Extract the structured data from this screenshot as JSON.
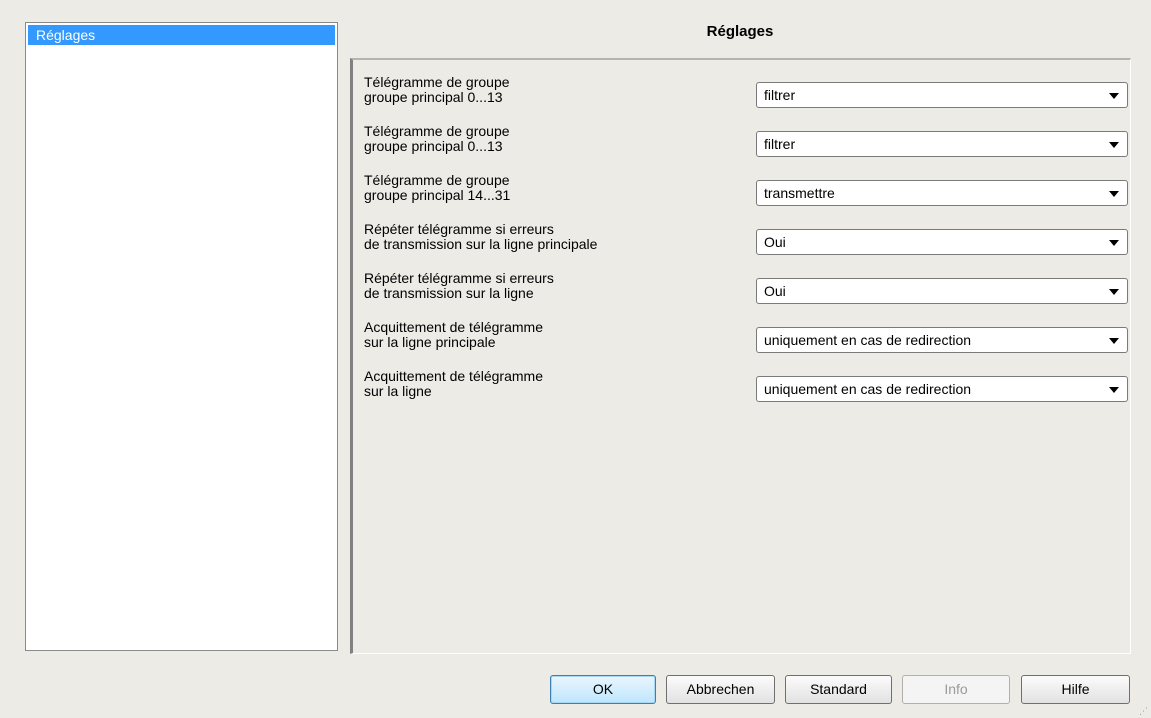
{
  "tree": {
    "items": [
      {
        "label": "Réglages",
        "selected": true
      }
    ]
  },
  "page_title": "Réglages",
  "parameters": [
    {
      "label_line1": "Télégramme de groupe",
      "label_line2": "groupe principal 0...13",
      "value": "filtrer"
    },
    {
      "label_line1": "Télégramme de groupe",
      "label_line2": "groupe principal 0...13",
      "value": "filtrer"
    },
    {
      "label_line1": "Télégramme de groupe",
      "label_line2": "groupe principal 14...31",
      "value": "transmettre"
    },
    {
      "label_line1": "Répéter télégramme si erreurs",
      "label_line2": "de transmission sur la ligne principale",
      "value": "Oui"
    },
    {
      "label_line1": "Répéter télégramme si erreurs",
      "label_line2": "de transmission sur la ligne",
      "value": "Oui"
    },
    {
      "label_line1": "Acquittement de télégramme",
      "label_line2": "sur la ligne principale",
      "value": "uniquement en cas de redirection"
    },
    {
      "label_line1": "Acquittement de télégramme",
      "label_line2": "sur la ligne",
      "value": "uniquement en cas de redirection"
    }
  ],
  "buttons": {
    "ok": "OK",
    "cancel": "Abbrechen",
    "standard": "Standard",
    "info": "Info",
    "help": "Hilfe"
  },
  "icons": {
    "dropdown": "chevron-down-icon",
    "resize_grip": "resize-grip-icon"
  },
  "colors": {
    "selection": "#3399ff",
    "background": "#ecebe6"
  }
}
